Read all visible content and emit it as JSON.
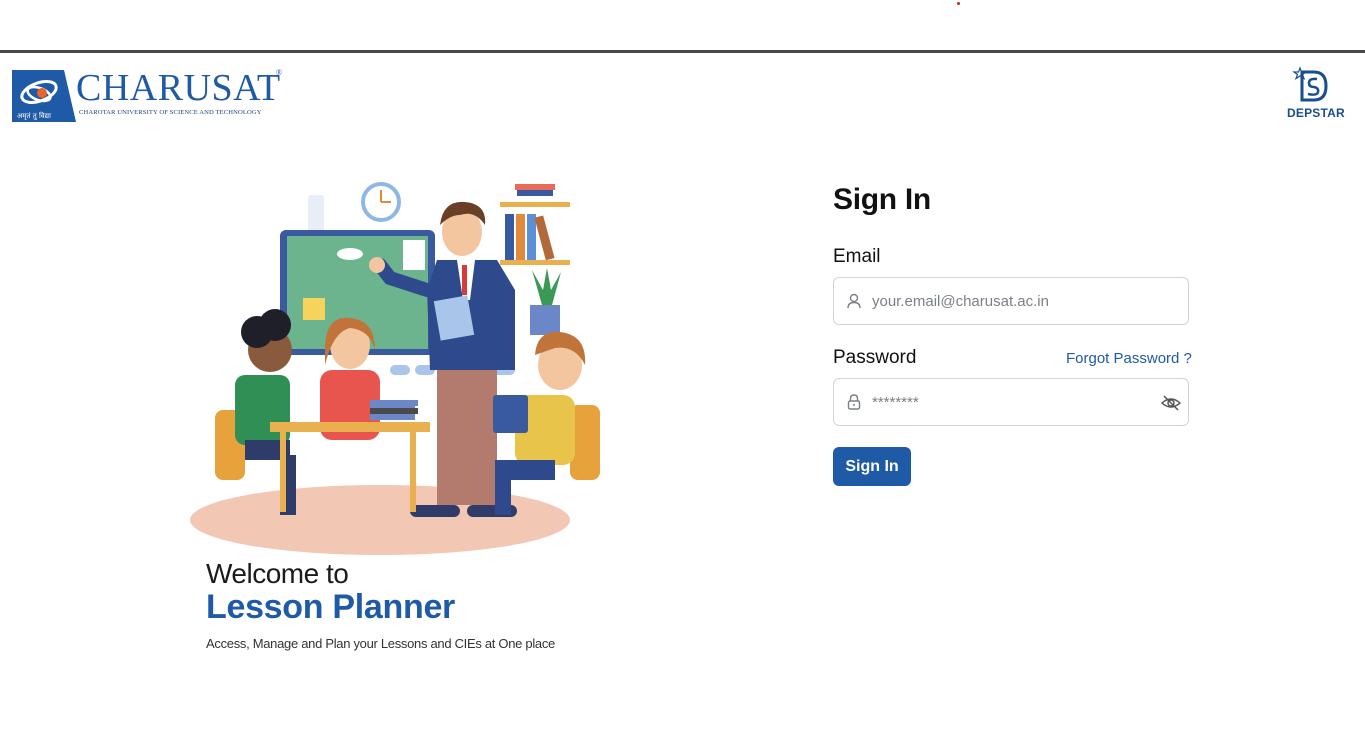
{
  "header": {
    "left_logo": {
      "wordmark": "CHARUSAT",
      "registered_mark": "®",
      "subtitle": "CHAROTAR UNIVERSITY OF SCIENCE AND TECHNOLOGY",
      "emblem_motto": "अमृतं तु विद्या"
    },
    "right_logo": {
      "wordmark": "DEPSTAR"
    }
  },
  "hero": {
    "welcome": "Welcome to",
    "app_name": "Lesson Planner",
    "tagline": "Access, Manage and Plan your Lessons and CIEs at One place"
  },
  "form": {
    "title": "Sign In",
    "email_label": "Email",
    "email_placeholder": "your.email@charusat.ac.in",
    "password_label": "Password",
    "forgot_password": "Forgot Password ?",
    "password_placeholder": "********",
    "submit_label": "Sign In",
    "icons": [
      "user-icon",
      "lock-icon",
      "eye-off-icon"
    ]
  },
  "colors": {
    "brand_blue": "#1f5aa6",
    "input_border": "#cfd4da",
    "top_rule": "#4a4a4a"
  }
}
